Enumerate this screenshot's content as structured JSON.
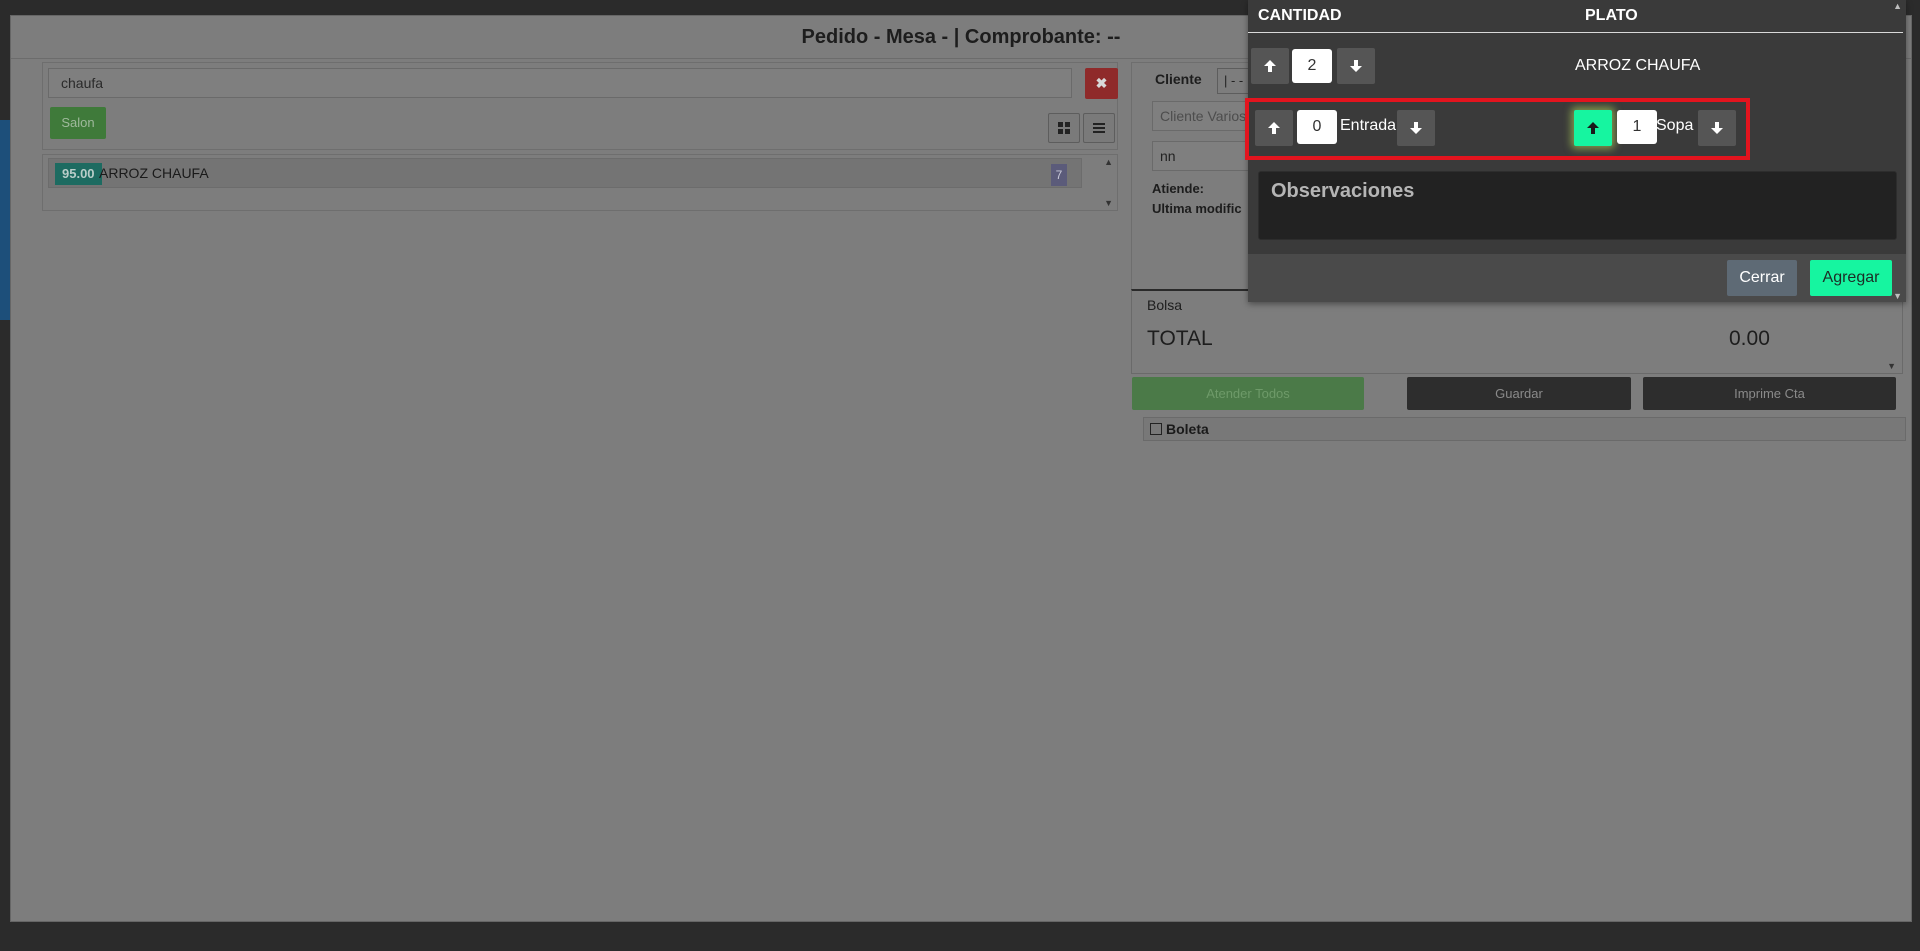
{
  "modal": {
    "title": "Pedido - Mesa - | Comprobante: --"
  },
  "search": {
    "value": "chaufa",
    "clear_icon": "✖"
  },
  "salon_button": "Salon",
  "result": {
    "price": "95.00",
    "name": "ARROZ CHAUFA",
    "count": "7"
  },
  "order": {
    "cliente_label": "Cliente",
    "cliente_select": "| - -",
    "cliente_placeholder": "Cliente Varios",
    "nn_value": "nn",
    "atiende_label": "Atiende:",
    "ultima_label": "Ultima modific"
  },
  "totals": {
    "bolsa_label": "Bolsa",
    "total_label": "TOTAL",
    "total_value": "0.00"
  },
  "actions": {
    "atender": "Atender Todos",
    "guardar": "Guardar",
    "imprime": "Imprime Cta"
  },
  "boleta_label": "Boleta",
  "popup": {
    "header_cantidad": "CANTIDAD",
    "header_plato": "PLATO",
    "quantity": "2",
    "dish_name": "ARROZ CHAUFA",
    "options": [
      {
        "label": "Entrada",
        "value": "0"
      },
      {
        "label": "Sopa",
        "value": "1"
      }
    ],
    "observaciones_placeholder": "Observaciones",
    "cerrar": "Cerrar",
    "agregar": "Agregar"
  },
  "colors": {
    "accent": "#16f5a0",
    "highlight": "#e3141e",
    "danger": "#8f2a2a"
  }
}
